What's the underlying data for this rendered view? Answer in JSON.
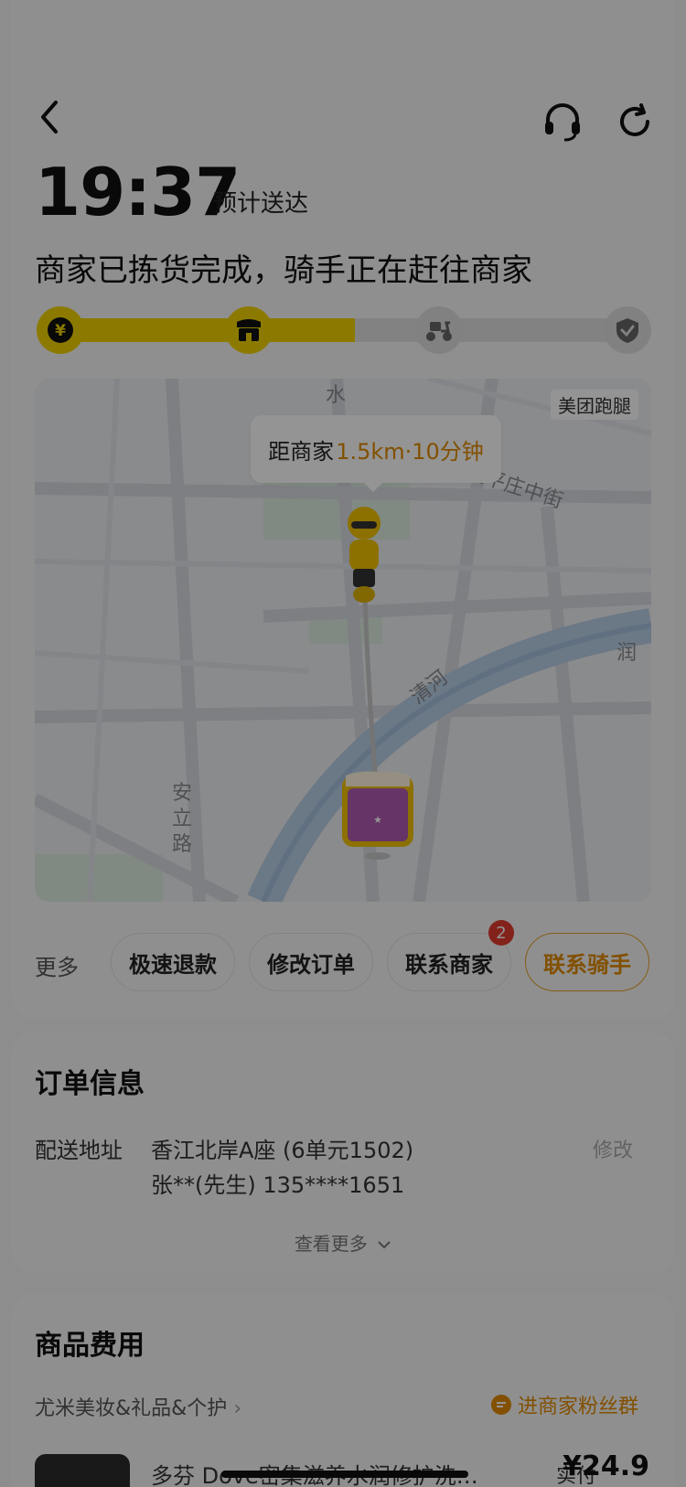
{
  "header": {
    "back_icon": "chevron-left-icon",
    "support_icon": "headset-icon",
    "refresh_icon": "refresh-icon"
  },
  "eta": {
    "time": "19:37",
    "label": "预计送达"
  },
  "status_text": "商家已拣货完成，骑手正在赶往商家",
  "progress": {
    "steps": [
      {
        "icon": "yen-icon",
        "state": "done"
      },
      {
        "icon": "store-icon",
        "state": "done"
      },
      {
        "icon": "scooter-icon",
        "state": "pending"
      },
      {
        "icon": "check-icon",
        "state": "pending"
      }
    ],
    "completed_fraction": 0.52,
    "accent_color": "#f2d200"
  },
  "map": {
    "brand_label": "美团跑腿",
    "bubble_prefix": "距商家",
    "bubble_distance": "1.5km·10分钟",
    "street_labels": [
      "水",
      "太平庄中街",
      "清河",
      "安立路",
      "润"
    ],
    "rider_icon": "rider-icon",
    "shop_marker_icon": "shop-marker-icon"
  },
  "actions": {
    "more_label": "更多",
    "buttons": [
      {
        "label": "极速退款"
      },
      {
        "label": "修改订单"
      },
      {
        "label": "联系商家",
        "badge": "2"
      },
      {
        "label": "联系骑手",
        "primary": true
      }
    ]
  },
  "order_info": {
    "title": "订单信息",
    "address_label": "配送地址",
    "address_line1": "香江北岸A座 (6单元1502)",
    "address_line2": "张**(先生) 135****1651",
    "edit_label": "修改",
    "see_more_label": "查看更多"
  },
  "goods": {
    "title": "商品费用",
    "shop_name": "尤米美妆&礼品&个护",
    "fans_group_label": "进商家粉丝群",
    "item_name": "多芬 Dove密集滋养水润修护洗…",
    "paid_label": "实付",
    "paid_amount": "¥24.9"
  }
}
